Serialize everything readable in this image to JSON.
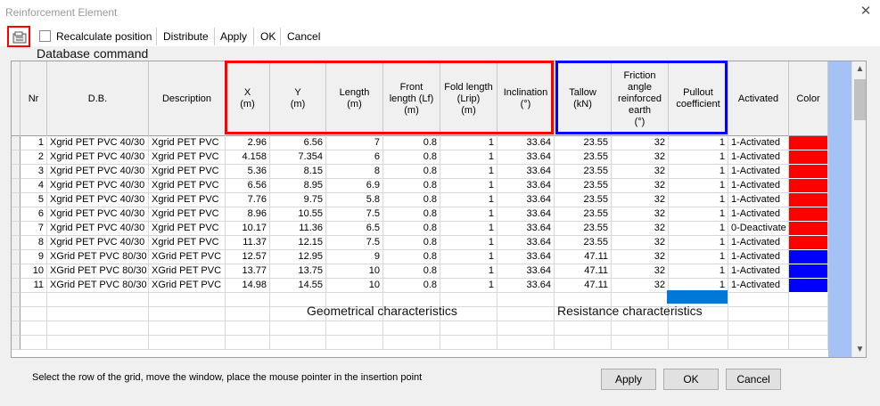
{
  "window": {
    "title": "Reinforcement Element",
    "close_symbol": "✕"
  },
  "toolbar": {
    "recalculate_label": "Recalculate position",
    "distribute_label": "Distribute",
    "apply_label": "Apply",
    "ok_label": "OK",
    "cancel_label": "Cancel"
  },
  "annotations": {
    "database_command": "Database command",
    "geometrical": "Geometrical characteristics",
    "resistance": "Resistance characteristics"
  },
  "table": {
    "headers": {
      "nr": "Nr",
      "db": "D.B.",
      "description": "Description",
      "x": "X|(m)",
      "y": "Y|(m)",
      "length": "Length|(m)",
      "front_length": "Front|length (Lf)|(m)",
      "fold_length": "Fold length|(Lrip)|(m)",
      "inclination": "Inclination|(°)",
      "tallow": "Tallow|(kN)",
      "friction": "Friction|angle|reinforced|earth|(°)",
      "pullout": "Pullout|coefficient",
      "activated": "Activated",
      "color": "Color"
    },
    "rows": [
      {
        "nr": "1",
        "db": "Xgrid PET PVC 40/30",
        "desc": "Xgrid PET PVC",
        "x": "2.96",
        "y": "6.56",
        "len": "7",
        "lf": "0.8",
        "lrip": "1",
        "inc": "33.64",
        "tallow": "23.55",
        "fric": "32",
        "pull": "1",
        "act": "1-Activated",
        "color": "#ff0000"
      },
      {
        "nr": "2",
        "db": "Xgrid PET PVC 40/30",
        "desc": "Xgrid PET PVC",
        "x": "4.158",
        "y": "7.354",
        "len": "6",
        "lf": "0.8",
        "lrip": "1",
        "inc": "33.64",
        "tallow": "23.55",
        "fric": "32",
        "pull": "1",
        "act": "1-Activated",
        "color": "#ff0000"
      },
      {
        "nr": "3",
        "db": "Xgrid PET PVC 40/30",
        "desc": "Xgrid PET PVC",
        "x": "5.36",
        "y": "8.15",
        "len": "8",
        "lf": "0.8",
        "lrip": "1",
        "inc": "33.64",
        "tallow": "23.55",
        "fric": "32",
        "pull": "1",
        "act": "1-Activated",
        "color": "#ff0000"
      },
      {
        "nr": "4",
        "db": "Xgrid PET PVC 40/30",
        "desc": "Xgrid PET PVC",
        "x": "6.56",
        "y": "8.95",
        "len": "6.9",
        "lf": "0.8",
        "lrip": "1",
        "inc": "33.64",
        "tallow": "23.55",
        "fric": "32",
        "pull": "1",
        "act": "1-Activated",
        "color": "#ff0000"
      },
      {
        "nr": "5",
        "db": "Xgrid PET PVC 40/30",
        "desc": "Xgrid PET PVC",
        "x": "7.76",
        "y": "9.75",
        "len": "5.8",
        "lf": "0.8",
        "lrip": "1",
        "inc": "33.64",
        "tallow": "23.55",
        "fric": "32",
        "pull": "1",
        "act": "1-Activated",
        "color": "#ff0000"
      },
      {
        "nr": "6",
        "db": "Xgrid PET PVC 40/30",
        "desc": "Xgrid PET PVC",
        "x": "8.96",
        "y": "10.55",
        "len": "7.5",
        "lf": "0.8",
        "lrip": "1",
        "inc": "33.64",
        "tallow": "23.55",
        "fric": "32",
        "pull": "1",
        "act": "1-Activated",
        "color": "#ff0000"
      },
      {
        "nr": "7",
        "db": "Xgrid PET PVC 40/30",
        "desc": "Xgrid PET PVC",
        "x": "10.17",
        "y": "11.36",
        "len": "6.5",
        "lf": "0.8",
        "lrip": "1",
        "inc": "33.64",
        "tallow": "23.55",
        "fric": "32",
        "pull": "1",
        "act": "0-Deactivate",
        "color": "#ff0000"
      },
      {
        "nr": "8",
        "db": "Xgrid PET PVC 40/30",
        "desc": "Xgrid PET PVC",
        "x": "11.37",
        "y": "12.15",
        "len": "7.5",
        "lf": "0.8",
        "lrip": "1",
        "inc": "33.64",
        "tallow": "23.55",
        "fric": "32",
        "pull": "1",
        "act": "1-Activated",
        "color": "#ff0000"
      },
      {
        "nr": "9",
        "db": "XGrid PET PVC 80/30",
        "desc": "XGrid PET PVC",
        "x": "12.57",
        "y": "12.95",
        "len": "9",
        "lf": "0.8",
        "lrip": "1",
        "inc": "33.64",
        "tallow": "47.11",
        "fric": "32",
        "pull": "1",
        "act": "1-Activated",
        "color": "#0000ff"
      },
      {
        "nr": "10",
        "db": "XGrid PET PVC 80/30",
        "desc": "XGrid PET PVC",
        "x": "13.77",
        "y": "13.75",
        "len": "10",
        "lf": "0.8",
        "lrip": "1",
        "inc": "33.64",
        "tallow": "47.11",
        "fric": "32",
        "pull": "1",
        "act": "1-Activated",
        "color": "#0000ff"
      },
      {
        "nr": "11",
        "db": "XGrid PET PVC 80/30",
        "desc": "XGrid PET PVC",
        "x": "14.98",
        "y": "14.55",
        "len": "10",
        "lf": "0.8",
        "lrip": "1",
        "inc": "33.64",
        "tallow": "47.11",
        "fric": "32",
        "pull": "1",
        "act": "1-Activated",
        "color": "#0000ff"
      }
    ],
    "empty_rows": 4
  },
  "highlights": {
    "geometry_box_color": "#ff0000",
    "resistance_box_color": "#0000ff",
    "legend_color": "#0078d7"
  },
  "footer": {
    "instruction": "Select the row of the grid, move the window, place the mouse pointer in the insertion point",
    "apply_label": "Apply",
    "ok_label": "OK",
    "cancel_label": "Cancel"
  }
}
